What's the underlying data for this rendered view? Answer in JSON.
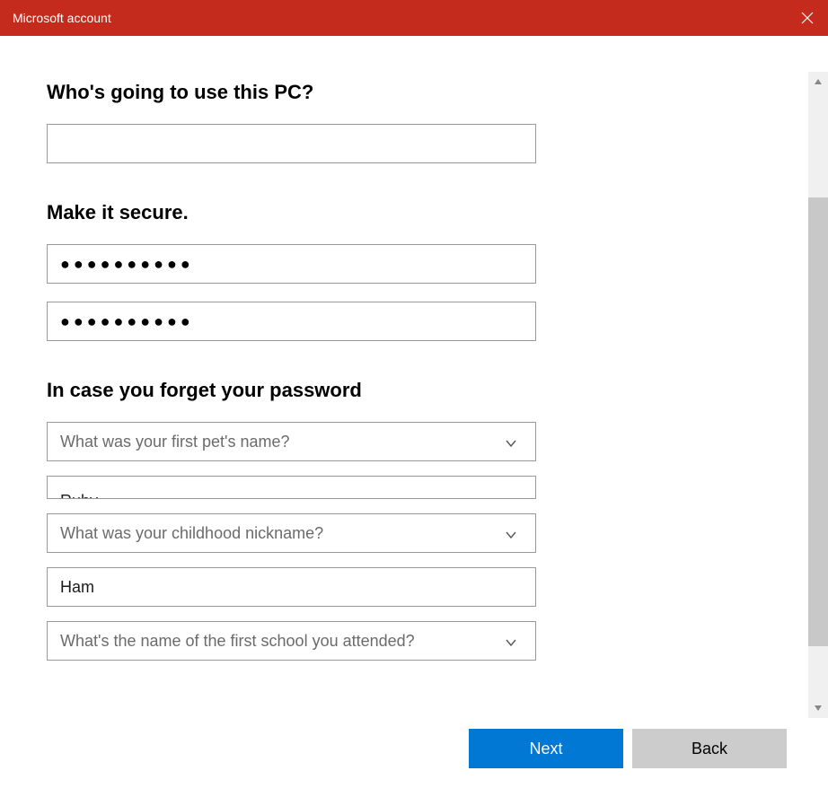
{
  "titlebar": {
    "title": "Microsoft account"
  },
  "sections": {
    "who": {
      "heading": "Who's going to use this PC?",
      "username_value": ""
    },
    "secure": {
      "heading": "Make it secure.",
      "password_display": "●●●●●●●●●●",
      "confirm_display": "●●●●●●●●●●"
    },
    "recovery": {
      "heading": "In case you forget your password",
      "q1": {
        "selected": "What was your first pet's name?",
        "answer": "Ruby"
      },
      "q2": {
        "selected": "What was your childhood nickname?",
        "answer": "Ham"
      },
      "q3": {
        "selected": "What's the name of the first school you attended?"
      }
    }
  },
  "buttons": {
    "next": "Next",
    "back": "Back"
  },
  "colors": {
    "titlebar_bg": "#c42b1c",
    "primary_button": "#0078d4",
    "secondary_button": "#cccccc"
  }
}
